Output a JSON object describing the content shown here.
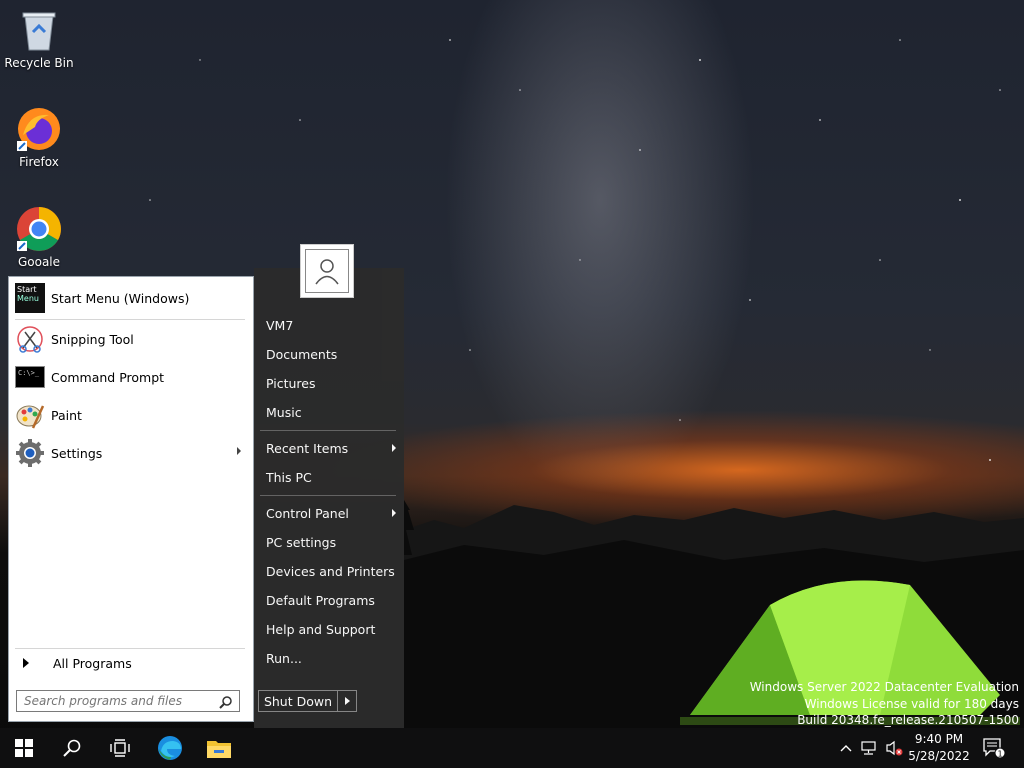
{
  "desktop": {
    "icons": [
      {
        "label": "Recycle Bin",
        "icon": "recycle-bin-icon"
      },
      {
        "label": "Firefox",
        "icon": "firefox-icon"
      },
      {
        "label": "Gooale",
        "icon": "chrome-icon"
      }
    ],
    "watermark": {
      "line1": "Windows Server 2022 Datacenter Evaluation",
      "line2": "Windows License valid for 180 days",
      "line3": "Build 20348.fe_release.210507-1500"
    }
  },
  "start_menu": {
    "pinned": [
      {
        "label": "Start Menu (Windows)",
        "icon": "start-menu-icon"
      },
      {
        "label": "Snipping Tool",
        "icon": "snipping-tool-icon"
      },
      {
        "label": "Command Prompt",
        "icon": "command-prompt-icon"
      },
      {
        "label": "Paint",
        "icon": "paint-icon"
      },
      {
        "label": "Settings",
        "icon": "settings-gear-icon",
        "submenu": true
      }
    ],
    "start_icon_text": [
      "Start",
      "Menu"
    ],
    "cmd_icon_text": "C:\\>_",
    "all_programs": "All Programs",
    "search": {
      "placeholder": "Search programs and files",
      "value": ""
    },
    "right": {
      "user": "VM7",
      "items_group1": [
        "Documents",
        "Pictures",
        "Music"
      ],
      "recent_items": "Recent Items",
      "this_pc": "This PC",
      "control_panel": "Control Panel",
      "items_group3": [
        "PC settings",
        "Devices and Printers",
        "Default Programs",
        "Help and Support",
        "Run..."
      ]
    },
    "shutdown": "Shut Down"
  },
  "taskbar": {
    "buttons": [
      "start-windows-icon",
      "search-icon",
      "task-view-icon",
      "edge-icon",
      "file-explorer-icon"
    ],
    "clock": {
      "time": "9:40 PM",
      "date": "5/28/2022"
    },
    "notifications_count": "1"
  },
  "colors": {
    "taskbar": "#0f0f10",
    "start_right_bg": "#2b2b2b",
    "text_light": "#ffffff"
  }
}
